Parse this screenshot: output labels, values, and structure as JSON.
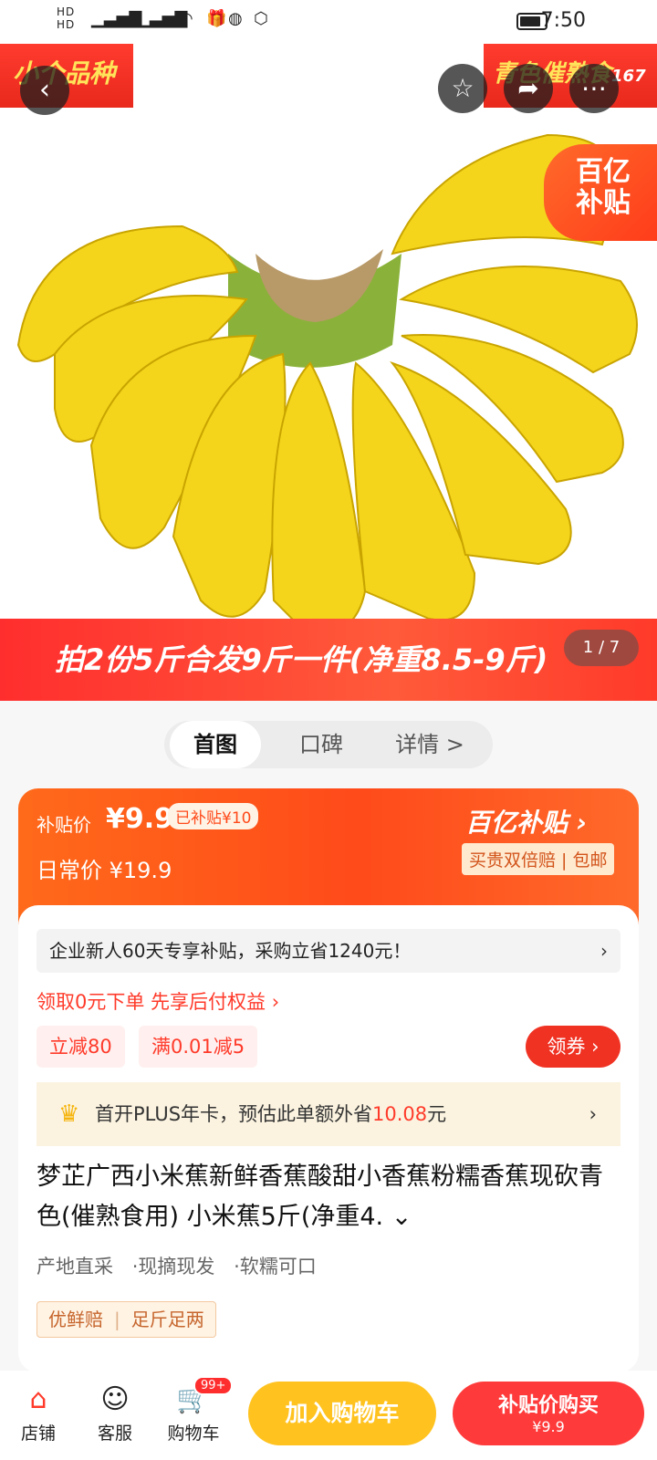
{
  "status": {
    "sim": "HD 1\nHD 2",
    "net1": "4G",
    "net2": "4G",
    "time": "7:50"
  },
  "hero": {
    "tag_left": "小个品种",
    "tag_right": "青色催熟食",
    "tag_right_num": "167",
    "subsidy_line1": "百亿",
    "subsidy_line2": "补贴",
    "promo": "拍2份5斤合发9斤一件(净重8.5-9斤)",
    "pager": "1 / 7"
  },
  "tabs": [
    {
      "label": "首图"
    },
    {
      "label": "口碑"
    },
    {
      "label": "详情 >"
    }
  ],
  "price": {
    "sub_label": "补贴价",
    "sub_price": "¥9.9",
    "already": "已补贴¥10",
    "daily": "日常价 ¥19.9",
    "brand": "百亿补贴 ›",
    "brand_sub": "买贵双倍赔 | 包邮"
  },
  "offers": {
    "newuser": "企业新人60天专享补贴，采购立省1240元！",
    "zero": "领取0元下单 先享后付权益 ›",
    "chip1": "立减80",
    "chip2": "满0.01减5",
    "coupon": "领券 ›",
    "plus_prefix": "首开PLUS年卡，预估此单额外省",
    "plus_amount": "10.08",
    "plus_suffix": "元"
  },
  "product": {
    "title": "梦芷广西小米蕉新鲜香蕉酸甜小香蕉粉糯香蕉现砍青色(催熟食用) 小米蕉5斤(净重4. ⌄",
    "features": [
      "产地直采",
      "·现摘现发",
      "·软糯可口"
    ],
    "badge1": "优鲜赔",
    "badge2": "足斤足两"
  },
  "bottom": {
    "shop": "店铺",
    "service": "客服",
    "cart": "购物车",
    "cart_badge": "99+",
    "add_cart": "加入购物车",
    "buy_line1": "补贴价购买",
    "buy_line2": "¥9.9"
  },
  "colors": {
    "accent": "#ff3a2a",
    "yellow": "#ffc21f",
    "orange": "#ff6a1a"
  }
}
